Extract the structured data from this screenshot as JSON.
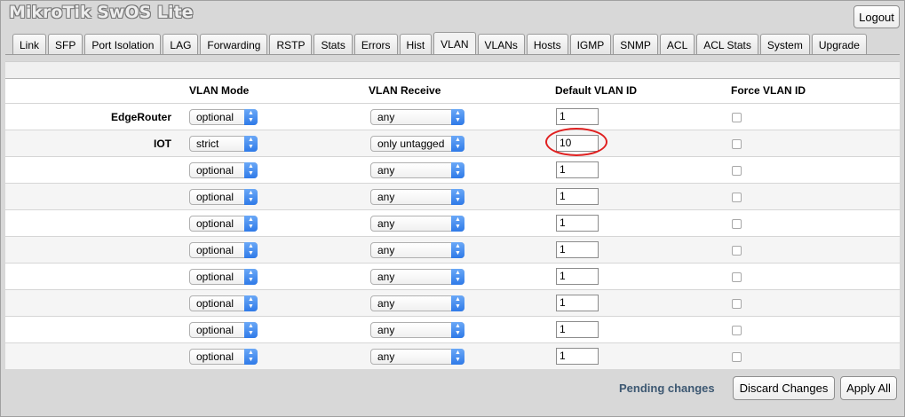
{
  "app": {
    "brand": "MikroTik SwOS Lite",
    "logout_label": "Logout"
  },
  "tabs": [
    {
      "label": "Link"
    },
    {
      "label": "SFP"
    },
    {
      "label": "Port Isolation"
    },
    {
      "label": "LAG"
    },
    {
      "label": "Forwarding"
    },
    {
      "label": "RSTP"
    },
    {
      "label": "Stats"
    },
    {
      "label": "Errors"
    },
    {
      "label": "Hist"
    },
    {
      "label": "VLAN"
    },
    {
      "label": "VLANs"
    },
    {
      "label": "Hosts"
    },
    {
      "label": "IGMP"
    },
    {
      "label": "SNMP"
    },
    {
      "label": "ACL"
    },
    {
      "label": "ACL Stats"
    },
    {
      "label": "System"
    },
    {
      "label": "Upgrade"
    }
  ],
  "active_tab": "VLAN",
  "table": {
    "headers": {
      "vlan_mode": "VLAN Mode",
      "vlan_receive": "VLAN Receive",
      "default_vlan_id": "Default VLAN ID",
      "force_vlan_id": "Force VLAN ID"
    },
    "rows": [
      {
        "name": "EdgeRouter",
        "mode": "optional",
        "receive": "any",
        "vid": "1",
        "force": false
      },
      {
        "name": "IOT",
        "mode": "strict",
        "receive": "only untagged",
        "vid": "10",
        "force": false
      },
      {
        "name": "",
        "mode": "optional",
        "receive": "any",
        "vid": "1",
        "force": false
      },
      {
        "name": "",
        "mode": "optional",
        "receive": "any",
        "vid": "1",
        "force": false
      },
      {
        "name": "",
        "mode": "optional",
        "receive": "any",
        "vid": "1",
        "force": false
      },
      {
        "name": "",
        "mode": "optional",
        "receive": "any",
        "vid": "1",
        "force": false
      },
      {
        "name": "",
        "mode": "optional",
        "receive": "any",
        "vid": "1",
        "force": false
      },
      {
        "name": "",
        "mode": "optional",
        "receive": "any",
        "vid": "1",
        "force": false
      },
      {
        "name": "",
        "mode": "optional",
        "receive": "any",
        "vid": "1",
        "force": false
      },
      {
        "name": "",
        "mode": "optional",
        "receive": "any",
        "vid": "1",
        "force": false
      }
    ]
  },
  "footer": {
    "pending": "Pending changes",
    "discard_label": "Discard Changes",
    "apply_label": "Apply All"
  },
  "colors": {
    "highlight_ring": "#e02020",
    "select_arrow": "#2f7ae8",
    "pending_text": "#3d5872"
  }
}
